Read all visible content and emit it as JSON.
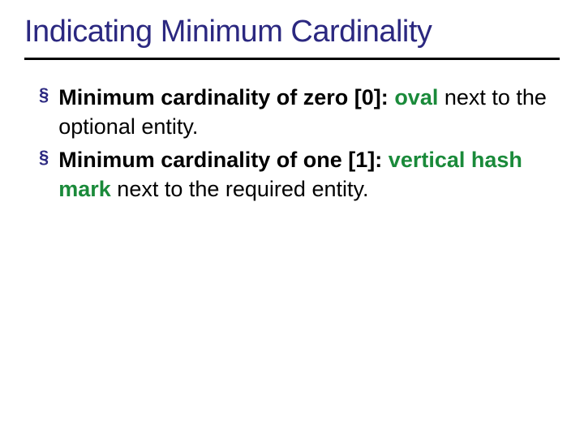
{
  "title": "Indicating Minimum Cardinality",
  "bullets": [
    {
      "mark": "§",
      "segments": {
        "s0": "Minimum cardinality of zero [0]:",
        "s1": " ",
        "s2": "oval",
        "s3": " next to the optional entity."
      }
    },
    {
      "mark": "§",
      "segments": {
        "s0": "Minimum cardinality of one [1]:",
        "s1": " ",
        "s2": "vertical hash mark",
        "s3": " next to the required entity."
      }
    }
  ]
}
